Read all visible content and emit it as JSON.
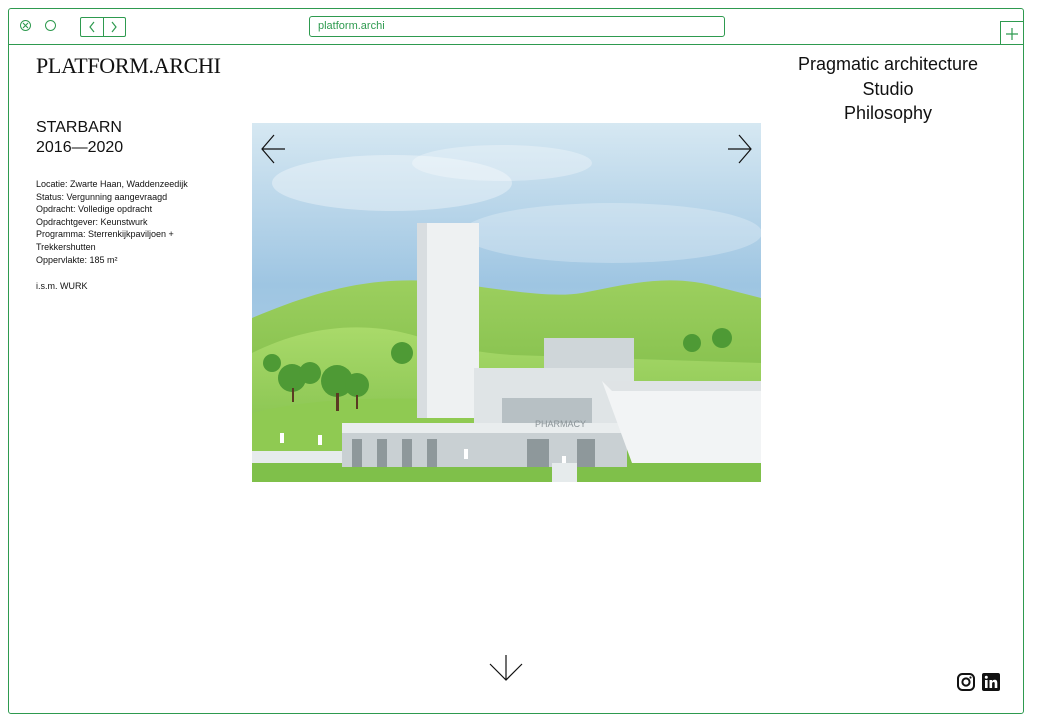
{
  "browser": {
    "url": "platform.archi",
    "icons": [
      "close-icon",
      "minimize-icon",
      "back-icon",
      "forward-icon",
      "plus-icon"
    ]
  },
  "site": {
    "logo": "PLATFORM.ARCHI",
    "nav": [
      "Pragmatic architecture",
      "Studio",
      "Philosophy"
    ]
  },
  "project": {
    "name": "STARBARN",
    "years": "2016—2020",
    "details": [
      "Locatie: Zwarte Haan, Waddenzeedijk",
      "Status: Vergunning aangevraagd",
      "Opdracht: Volledige opdracht",
      "Opdrachtgever: Keunstwurk",
      "Programma: Sterrenkijkpaviljoen +",
      "Trekkershutten",
      "Oppervlakte: 185 m²"
    ],
    "credit": "i.s.m. WURK"
  },
  "hero": {
    "sign": "PHARMACY",
    "icons": [
      "arrow-left-icon",
      "arrow-right-icon",
      "arrow-down-icon"
    ]
  },
  "social": [
    "instagram-icon",
    "linkedin-icon"
  ],
  "colors": {
    "accent": "#2e9a4f",
    "text": "#111111"
  }
}
